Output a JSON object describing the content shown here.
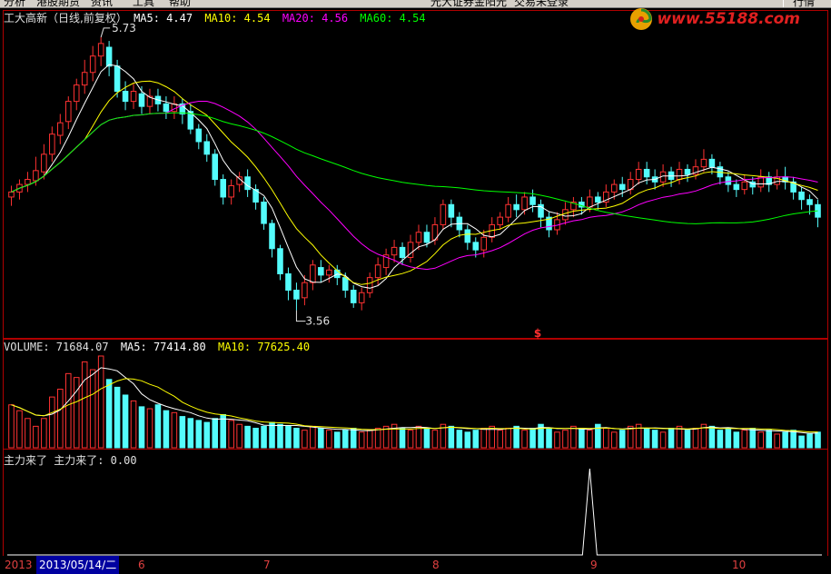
{
  "menu": {
    "items": [
      "分析",
      "港股期货",
      "资讯",
      "工具",
      "帮助"
    ],
    "center_items": [
      "光大证券金阳光",
      "交易未登录"
    ],
    "corner": "行情"
  },
  "watermark": {
    "text": "www.55188.com",
    "logo": "swirl-logo-icon"
  },
  "price_panel": {
    "stock_name": "工大高新（日线,前复权）",
    "ma5": "MA5: 4.47",
    "ma10": "MA10: 4.54",
    "ma20": "MA20: 4.56",
    "ma60": "MA60: 4.54",
    "high_label": "5.73",
    "low_label": "3.56",
    "dividend_marker": "$"
  },
  "volume_panel": {
    "volume": "VOLUME: 71684.07",
    "ma5": "MA5: 77414.80",
    "ma10": "MA10: 77625.40"
  },
  "indicator_panel": {
    "name": "主力来了 主力来了: 0.00"
  },
  "x_axis": {
    "year": "2013",
    "cursor_date": "2013/05/14/二",
    "months": [
      "6",
      "7",
      "8",
      "9",
      "10"
    ]
  },
  "colors": {
    "up": "#ff3232",
    "down": "#54fcfc",
    "ma5": "#ffffff",
    "ma10": "#ffff00",
    "ma20": "#ff00ff",
    "ma60": "#00ff00",
    "panel_border": "#b00000",
    "text_default": "#c0c0c0"
  },
  "chart_data": {
    "type": "candlestick",
    "title": "工大高新（日线,前复权）",
    "price_range": [
      3.56,
      5.73
    ],
    "annotations": {
      "high": 5.73,
      "low": 3.56
    },
    "moving_averages": {
      "MA5": 4.47,
      "MA10": 4.54,
      "MA20": 4.56,
      "MA60": 4.54
    },
    "volume": {
      "VOLUME": 71684.07,
      "MA5": 77414.8,
      "MA10": 77625.4
    },
    "indicator": {
      "主力来了": 0.0
    },
    "x_ticks": [
      "2013",
      "6",
      "7",
      "8",
      "9",
      "10"
    ],
    "candles": [
      [
        4.46,
        4.5,
        4.39,
        4.55
      ],
      [
        4.5,
        4.56,
        4.44,
        4.6
      ],
      [
        4.56,
        4.6,
        4.5,
        4.66
      ],
      [
        4.59,
        4.67,
        4.55,
        4.78
      ],
      [
        4.66,
        4.8,
        4.6,
        4.88
      ],
      [
        4.8,
        4.96,
        4.74,
        5.02
      ],
      [
        4.95,
        5.05,
        4.88,
        5.12
      ],
      [
        5.06,
        5.22,
        5.0,
        5.26
      ],
      [
        5.22,
        5.35,
        5.15,
        5.4
      ],
      [
        5.35,
        5.45,
        5.28,
        5.55
      ],
      [
        5.45,
        5.58,
        5.38,
        5.66
      ],
      [
        5.58,
        5.68,
        5.5,
        5.73
      ],
      [
        5.65,
        5.5,
        5.42,
        5.7
      ],
      [
        5.5,
        5.3,
        5.25,
        5.55
      ],
      [
        5.3,
        5.22,
        5.15,
        5.38
      ],
      [
        5.22,
        5.3,
        5.16,
        5.36
      ],
      [
        5.28,
        5.18,
        5.12,
        5.34
      ],
      [
        5.18,
        5.26,
        5.12,
        5.32
      ],
      [
        5.26,
        5.2,
        5.14,
        5.32
      ],
      [
        5.2,
        5.14,
        5.08,
        5.26
      ],
      [
        5.14,
        5.2,
        5.08,
        5.26
      ],
      [
        5.2,
        5.12,
        5.04,
        5.24
      ],
      [
        5.14,
        5.0,
        4.96,
        5.2
      ],
      [
        5.0,
        4.9,
        4.84,
        5.04
      ],
      [
        4.9,
        4.8,
        4.74,
        4.96
      ],
      [
        4.8,
        4.6,
        4.55,
        4.84
      ],
      [
        4.6,
        4.46,
        4.4,
        4.64
      ],
      [
        4.46,
        4.55,
        4.4,
        4.6
      ],
      [
        4.56,
        4.62,
        4.5,
        4.66
      ],
      [
        4.62,
        4.52,
        4.46,
        4.68
      ],
      [
        4.52,
        4.42,
        4.36,
        4.56
      ],
      [
        4.42,
        4.25,
        4.2,
        4.46
      ],
      [
        4.25,
        4.05,
        3.98,
        4.28
      ],
      [
        4.05,
        3.85,
        3.8,
        4.08
      ],
      [
        3.85,
        3.72,
        3.64,
        3.9
      ],
      [
        3.72,
        3.65,
        3.56,
        3.78
      ],
      [
        3.66,
        3.78,
        3.6,
        3.84
      ],
      [
        3.78,
        3.92,
        3.72,
        3.96
      ],
      [
        3.9,
        3.84,
        3.78,
        3.96
      ],
      [
        3.84,
        3.88,
        3.78,
        3.92
      ],
      [
        3.88,
        3.82,
        3.76,
        3.92
      ],
      [
        3.82,
        3.72,
        3.66,
        3.86
      ],
      [
        3.72,
        3.62,
        3.58,
        3.76
      ],
      [
        3.62,
        3.7,
        3.56,
        3.74
      ],
      [
        3.7,
        3.82,
        3.66,
        3.86
      ],
      [
        3.82,
        3.92,
        3.76,
        3.98
      ],
      [
        3.9,
        4.0,
        3.84,
        4.05
      ],
      [
        4.0,
        4.06,
        3.94,
        4.12
      ],
      [
        4.06,
        3.98,
        3.92,
        4.1
      ],
      [
        3.98,
        4.1,
        3.94,
        4.16
      ],
      [
        4.1,
        4.18,
        4.04,
        4.24
      ],
      [
        4.18,
        4.1,
        4.06,
        4.24
      ],
      [
        4.12,
        4.24,
        4.08,
        4.3
      ],
      [
        4.24,
        4.4,
        4.2,
        4.44
      ],
      [
        4.4,
        4.3,
        4.22,
        4.44
      ],
      [
        4.3,
        4.2,
        4.14,
        4.34
      ],
      [
        4.2,
        4.1,
        4.04,
        4.24
      ],
      [
        4.1,
        4.04,
        3.98,
        4.14
      ],
      [
        4.04,
        4.14,
        3.98,
        4.2
      ],
      [
        4.14,
        4.24,
        4.1,
        4.3
      ],
      [
        4.24,
        4.3,
        4.2,
        4.34
      ],
      [
        4.3,
        4.4,
        4.26,
        4.46
      ],
      [
        4.4,
        4.36,
        4.3,
        4.48
      ],
      [
        4.36,
        4.46,
        4.32,
        4.5
      ],
      [
        4.46,
        4.4,
        4.34,
        4.52
      ],
      [
        4.4,
        4.3,
        4.22,
        4.44
      ],
      [
        4.3,
        4.2,
        4.14,
        4.34
      ],
      [
        4.2,
        4.28,
        4.16,
        4.34
      ],
      [
        4.28,
        4.36,
        4.24,
        4.42
      ],
      [
        4.36,
        4.42,
        4.3,
        4.46
      ],
      [
        4.42,
        4.38,
        4.32,
        4.46
      ],
      [
        4.38,
        4.46,
        4.34,
        4.52
      ],
      [
        4.46,
        4.42,
        4.36,
        4.5
      ],
      [
        4.42,
        4.5,
        4.38,
        4.56
      ],
      [
        4.5,
        4.56,
        4.44,
        4.6
      ],
      [
        4.56,
        4.52,
        4.46,
        4.62
      ],
      [
        4.52,
        4.6,
        4.48,
        4.66
      ],
      [
        4.6,
        4.68,
        4.56,
        4.74
      ],
      [
        4.68,
        4.62,
        4.56,
        4.74
      ],
      [
        4.62,
        4.58,
        4.52,
        4.68
      ],
      [
        4.58,
        4.66,
        4.54,
        4.72
      ],
      [
        4.66,
        4.6,
        4.54,
        4.7
      ],
      [
        4.6,
        4.68,
        4.56,
        4.74
      ],
      [
        4.68,
        4.64,
        4.58,
        4.72
      ],
      [
        4.64,
        4.7,
        4.6,
        4.76
      ],
      [
        4.7,
        4.76,
        4.66,
        4.84
      ],
      [
        4.76,
        4.7,
        4.64,
        4.8
      ],
      [
        4.7,
        4.62,
        4.56,
        4.74
      ],
      [
        4.62,
        4.56,
        4.5,
        4.66
      ],
      [
        4.56,
        4.52,
        4.46,
        4.6
      ],
      [
        4.52,
        4.58,
        4.48,
        4.64
      ],
      [
        4.58,
        4.54,
        4.48,
        4.62
      ],
      [
        4.54,
        4.62,
        4.5,
        4.68
      ],
      [
        4.62,
        4.56,
        4.5,
        4.66
      ],
      [
        4.56,
        4.62,
        4.52,
        4.68
      ],
      [
        4.62,
        4.58,
        4.52,
        4.7
      ],
      [
        4.58,
        4.5,
        4.44,
        4.62
      ],
      [
        4.5,
        4.44,
        4.36,
        4.54
      ],
      [
        4.44,
        4.4,
        4.32,
        4.48
      ],
      [
        4.4,
        4.3,
        4.22,
        4.44
      ]
    ],
    "volumes": [
      44,
      38,
      30,
      22,
      30,
      52,
      60,
      76,
      72,
      88,
      80,
      94,
      70,
      62,
      54,
      48,
      42,
      40,
      44,
      38,
      36,
      32,
      30,
      28,
      26,
      30,
      34,
      28,
      24,
      22,
      20,
      22,
      26,
      24,
      22,
      20,
      18,
      22,
      20,
      18,
      16,
      18,
      20,
      16,
      18,
      20,
      22,
      24,
      20,
      18,
      22,
      20,
      18,
      24,
      22,
      18,
      16,
      18,
      20,
      22,
      18,
      20,
      22,
      18,
      20,
      24,
      20,
      16,
      18,
      22,
      20,
      18,
      24,
      20,
      16,
      18,
      22,
      24,
      20,
      18,
      16,
      20,
      22,
      18,
      20,
      24,
      22,
      18,
      20,
      16,
      18,
      20,
      16,
      18,
      14,
      16,
      18,
      12,
      14,
      16
    ],
    "indicator_spike_index": 71
  }
}
